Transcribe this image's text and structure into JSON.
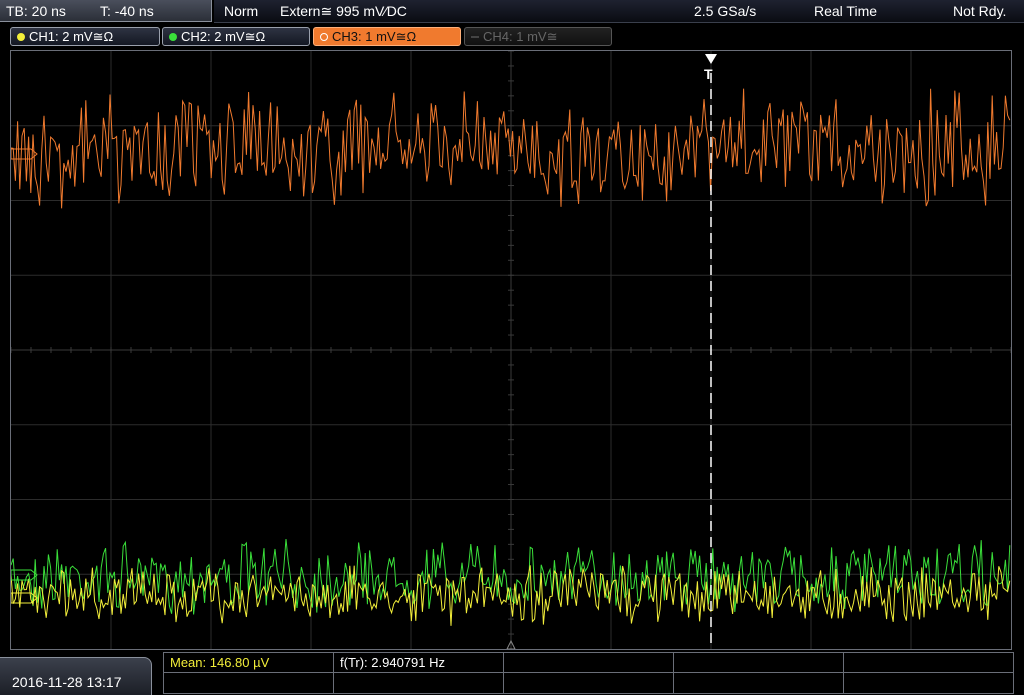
{
  "status_bar": {
    "timebase": "TB: 20 ns",
    "trigger_time": "T: -40 ns",
    "mode": "Norm",
    "trigger_source": "Extern",
    "trigger_coupling_icon": "≅",
    "trigger_level": "995 mV",
    "trigger_slope_icon": "rising-edge-icon",
    "trigger_slope": "⁄",
    "trigger_coupling": "DC",
    "sample_rate": "2.5 GSa/s",
    "acquisition": "Real Time",
    "state": "Not Rdy."
  },
  "channels": [
    {
      "label": "CH1: 2 mV≅Ω",
      "color": "#f2ee3a",
      "active": true
    },
    {
      "label": "CH2: 2 mV≅Ω",
      "color": "#3adf3a",
      "active": true
    },
    {
      "label": "CH3: 1 mV≅Ω",
      "color": "#f07a2e",
      "active": true,
      "selected": true
    },
    {
      "label": "CH4: 1 mV≅",
      "color": "#555555",
      "active": false
    }
  ],
  "screen": {
    "trigger_marker": "T",
    "trace_colors": {
      "ch1": "#f2ee3a",
      "ch2": "#3adf3a",
      "ch3": "#f07a2e"
    },
    "grid_divisions": {
      "horizontal": 10,
      "vertical": 8
    }
  },
  "measurements": {
    "mean": "Mean: 146.80 µV",
    "frequency": "f(Tr): 2.940791 Hz"
  },
  "datetime": "2016-11-28 13:17"
}
